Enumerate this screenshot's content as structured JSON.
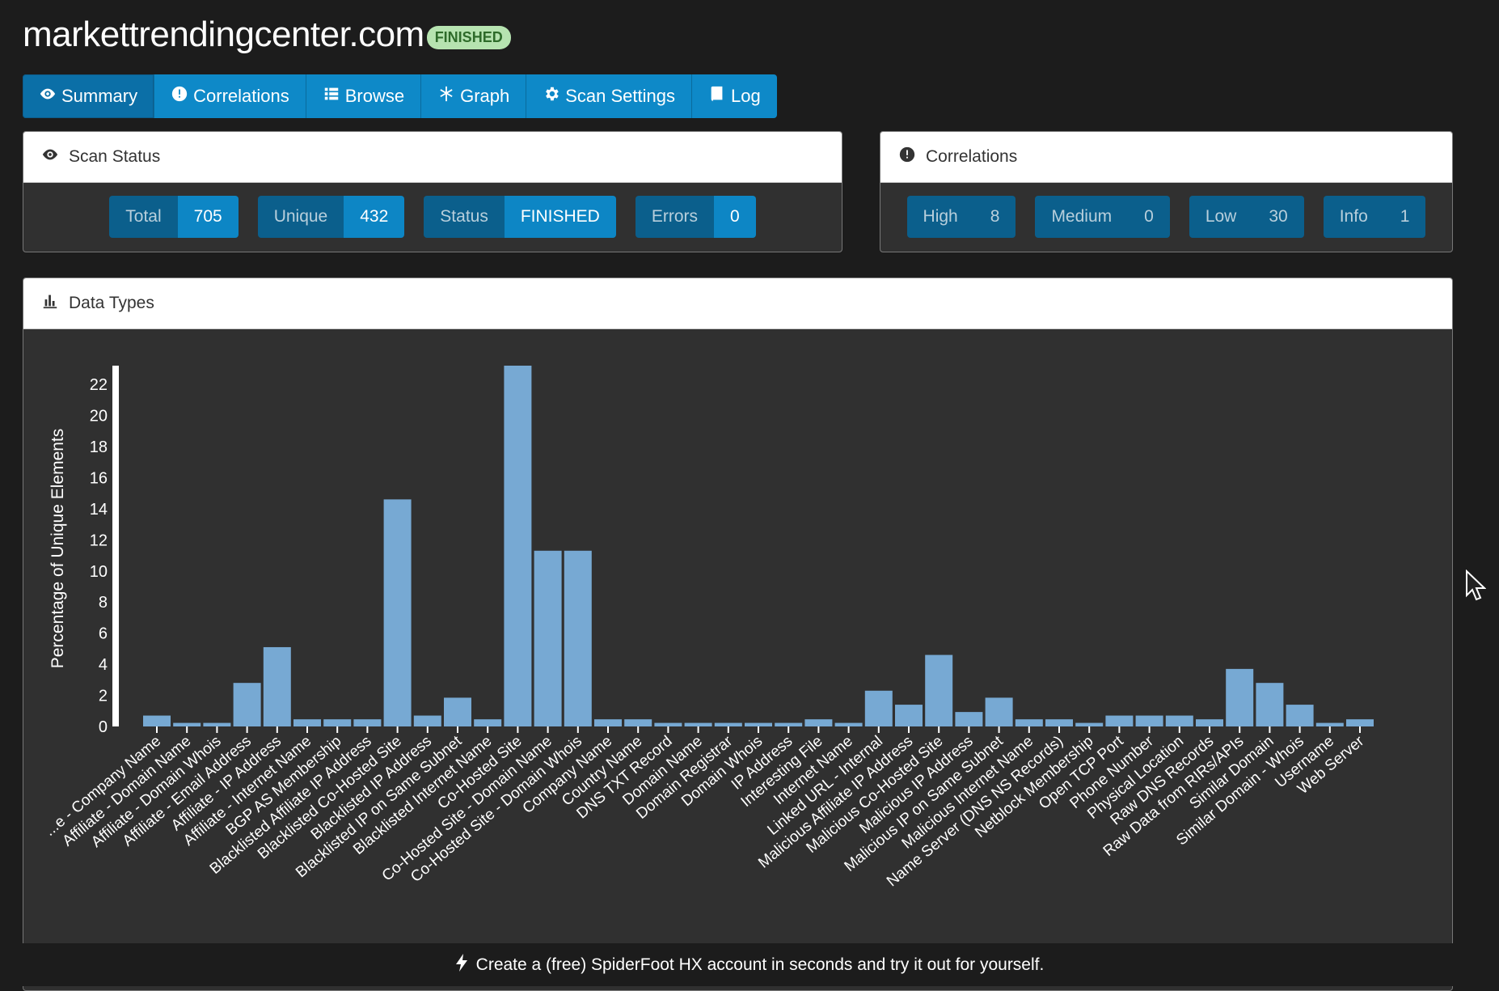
{
  "header": {
    "title": "markettrendingcenter.com",
    "status_badge": "FINISHED"
  },
  "tabs": [
    {
      "label": "Summary",
      "icon": "eye-icon",
      "active": true
    },
    {
      "label": "Correlations",
      "icon": "exclamation-circle-icon",
      "active": false
    },
    {
      "label": "Browse",
      "icon": "list-icon",
      "active": false
    },
    {
      "label": "Graph",
      "icon": "asterisk-icon",
      "active": false
    },
    {
      "label": "Scan Settings",
      "icon": "gear-icon",
      "active": false
    },
    {
      "label": "Log",
      "icon": "book-icon",
      "active": false
    }
  ],
  "scan_status": {
    "title": "Scan Status",
    "total_label": "Total",
    "total_value": "705",
    "unique_label": "Unique",
    "unique_value": "432",
    "status_label": "Status",
    "status_value": "FINISHED",
    "errors_label": "Errors",
    "errors_value": "0"
  },
  "correlations": {
    "title": "Correlations",
    "high_label": "High",
    "high_value": "8",
    "medium_label": "Medium",
    "medium_value": "0",
    "low_label": "Low",
    "low_value": "30",
    "info_label": "Info",
    "info_value": "1"
  },
  "data_types": {
    "title": "Data Types"
  },
  "chart_data": {
    "type": "bar",
    "title": "",
    "xlabel": "",
    "ylabel": "Percentage of Unique Elements",
    "ylim": [
      0,
      23.2
    ],
    "yticks": [
      0,
      2,
      4,
      6,
      8,
      10,
      12,
      14,
      16,
      18,
      20,
      22
    ],
    "categories": [
      "Affiliate - Company Name",
      "Affiliate - Domain Name",
      "Affiliate - Domain Whois",
      "Affiliate - Email Address",
      "Affiliate - IP Address",
      "Affiliate - Internet Name",
      "BGP AS Membership",
      "Blacklisted Affiliate IP Address",
      "Blacklisted Co-Hosted Site",
      "Blacklisted IP Address",
      "Blacklisted IP on Same Subnet",
      "Blacklisted Internet Name",
      "Co-Hosted Site",
      "Co-Hosted Site - Domain Name",
      "Co-Hosted Site - Domain Whois",
      "Company Name",
      "Country Name",
      "DNS TXT Record",
      "Domain Name",
      "Domain Registrar",
      "Domain Whois",
      "IP Address",
      "Interesting File",
      "Internet Name",
      "Linked URL - Internal",
      "Malicious Affiliate IP Address",
      "Malicious Co-Hosted Site",
      "Malicious IP Address",
      "Malicious IP on Same Subnet",
      "Malicious Internet Name",
      "Name Server (DNS NS Records)",
      "Netblock Membership",
      "Open TCP Port",
      "Phone Number",
      "Physical Location",
      "Raw DNS Records",
      "Raw Data from RIRs/APIs",
      "Similar Domain",
      "Similar Domain - Whois",
      "Username",
      "Web Server"
    ],
    "category_display": [
      "...e - Company Name",
      "Affiliate - Domain Name",
      "Affiliate - Domain Whois",
      "Affiliate - Email Address",
      "Affiliate - IP Address",
      "Affiliate - Internet Name",
      "BGP AS Membership",
      "Blacklisted Affiliate IP Address",
      "Blacklisted Co-Hosted Site",
      "Blacklisted IP Address",
      "Blacklisted IP on Same Subnet",
      "Blacklisted Internet Name",
      "Co-Hosted Site",
      "Co-Hosted Site - Domain Name",
      "Co-Hosted Site - Domain Whois",
      "Company Name",
      "Country Name",
      "DNS TXT Record",
      "Domain Name",
      "Domain Registrar",
      "Domain Whois",
      "IP Address",
      "Interesting File",
      "Internet Name",
      "Linked URL - Internal",
      "Malicious Affiliate IP Address",
      "Malicious Co-Hosted Site",
      "Malicious IP Address",
      "Malicious IP on Same Subnet",
      "Malicious Internet Name",
      "Name Server (DNS NS Records)",
      "Netblock Membership",
      "Open TCP Port",
      "Phone Number",
      "Physical Location",
      "Raw DNS Records",
      "Raw Data from RIRs/APIs",
      "Similar Domain",
      "Similar Domain - Whois",
      "Username",
      "Web Server"
    ],
    "values": [
      0.7,
      0.23,
      0.23,
      2.8,
      5.1,
      0.46,
      0.46,
      0.46,
      14.6,
      0.7,
      1.85,
      0.46,
      23.2,
      11.3,
      11.3,
      0.46,
      0.46,
      0.23,
      0.23,
      0.23,
      0.23,
      0.23,
      0.46,
      0.23,
      2.3,
      1.4,
      4.6,
      0.93,
      1.85,
      0.46,
      0.46,
      0.23,
      0.7,
      0.7,
      0.7,
      0.46,
      3.7,
      2.8,
      1.4,
      0.23,
      0.46
    ],
    "grid": false,
    "legend": "none"
  },
  "footer": {
    "text": "Create a (free) SpiderFoot HX account in seconds and try it out for yourself.",
    "icon": "bolt-icon"
  },
  "colors": {
    "accent": "#0e89c8",
    "bar": "#77a9d3",
    "panel_bg": "#303030",
    "page_bg": "#1c1c1c",
    "finished_badge": "#b6e3b0"
  }
}
